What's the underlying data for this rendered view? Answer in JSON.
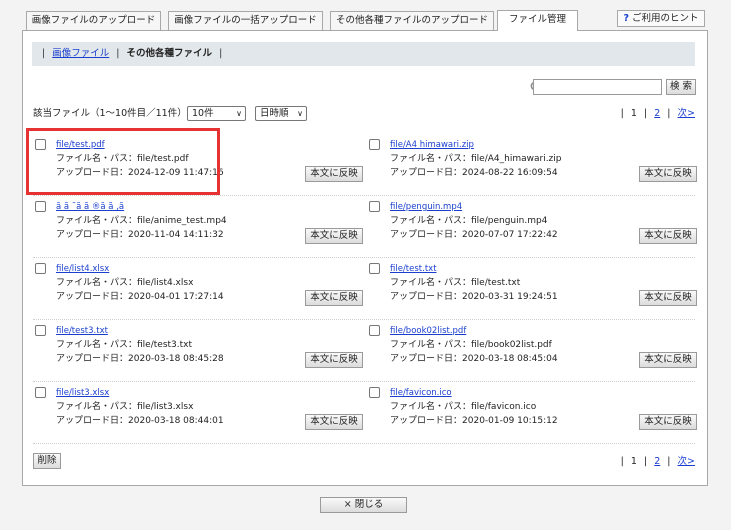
{
  "tabs": [
    {
      "label": "画像ファイルのアップロード"
    },
    {
      "label": "画像ファイルの一括アップロード"
    },
    {
      "label": "その他各種ファイルのアップロード"
    },
    {
      "label": "ファイル管理"
    }
  ],
  "hint": {
    "icon_text": "?",
    "label": "ご利用のヒント"
  },
  "subnav": {
    "sep": "|",
    "link": "画像ファイル",
    "current": "その他各種ファイル"
  },
  "search": {
    "value": "",
    "placeholder": "",
    "button_label": "検 索"
  },
  "result_count": "該当ファイル（1～10件目／11件）",
  "per_page": {
    "selected": "10件"
  },
  "sort": {
    "selected": "日時順"
  },
  "pager": {
    "sep": "|",
    "current": "1",
    "page2": "2",
    "next": "次>"
  },
  "labels": {
    "path_prefix": "ファイル名・パス：",
    "date_prefix": "アップロード日：",
    "apply_button": "本文に反映"
  },
  "files": [
    {
      "name": "file/test.pdf",
      "path": "file/test.pdf",
      "date": "2024-12-09 11:47:16"
    },
    {
      "name": "file/A4 himawari.zip",
      "path": "file/A4_himawari.zip",
      "date": "2024-08-22 16:09:54"
    },
    {
      "name": "ã ã ˜ã ã ®ã ã ‚ã",
      "path": "file/anime_test.mp4",
      "date": "2020-11-04 14:11:32"
    },
    {
      "name": "file/penguin.mp4",
      "path": "file/penguin.mp4",
      "date": "2020-07-07 17:22:42"
    },
    {
      "name": "file/list4.xlsx",
      "path": "file/list4.xlsx",
      "date": "2020-04-01 17:27:14"
    },
    {
      "name": "file/test.txt",
      "path": "file/test.txt",
      "date": "2020-03-31 19:24:51"
    },
    {
      "name": "file/test3.txt",
      "path": "file/test3.txt",
      "date": "2020-03-18 08:45:28"
    },
    {
      "name": "file/book02list.pdf",
      "path": "file/book02list.pdf",
      "date": "2020-03-18 08:45:04"
    },
    {
      "name": "file/list3.xlsx",
      "path": "file/list3.xlsx",
      "date": "2020-03-18 08:44:01"
    },
    {
      "name": "file/favicon.ico",
      "path": "file/favicon.ico",
      "date": "2020-01-09 10:15:12"
    }
  ],
  "delete_label": "削除",
  "close_label": "× 閉じる",
  "colors": {
    "link": "#1a3fcf",
    "highlight": "#e53333",
    "subnav_bg": "#e1e7ea"
  }
}
